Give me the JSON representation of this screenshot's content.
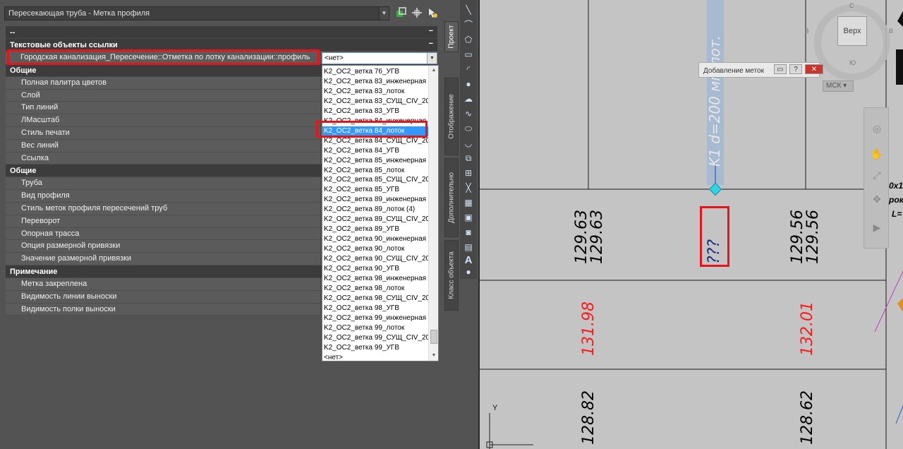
{
  "toolbar": {
    "object_type": "Пересекающая труба - Метка профиля",
    "icons": [
      "quick-select-icon",
      "pick-add-icon",
      "select-objects-icon"
    ]
  },
  "properties": {
    "categories": [
      {
        "label": "--",
        "toggle": "−",
        "rows": []
      },
      {
        "label": "Текстовые объекты ссылки",
        "toggle": "−",
        "rows": [
          {
            "name": "Городская канализация_Пересечение::Отметка по лотку канализации::профиль",
            "value": "<нет>"
          }
        ]
      },
      {
        "label": "Общие",
        "toggle": "−",
        "rows": [
          {
            "name": "Полная палитра цветов"
          },
          {
            "name": "Слой"
          },
          {
            "name": "Тип линий"
          },
          {
            "name": "ЛМасштаб"
          },
          {
            "name": "Стиль печати"
          },
          {
            "name": "Вес линий"
          },
          {
            "name": "Ссылка"
          }
        ]
      },
      {
        "label": "Общие",
        "toggle": "−",
        "rows": [
          {
            "name": "Труба"
          },
          {
            "name": "Вид профиля"
          },
          {
            "name": "Стиль меток профиля пересечений труб"
          },
          {
            "name": "Переворот"
          },
          {
            "name": "Опорная трасса"
          },
          {
            "name": "Опция размерной привязки"
          },
          {
            "name": "Значение размерной привязки"
          }
        ]
      },
      {
        "label": "Примечание",
        "toggle": "−",
        "rows": [
          {
            "name": "Метка закреплена"
          },
          {
            "name": "Видимость линии выноски"
          },
          {
            "name": "Видимость полки выноски"
          }
        ]
      }
    ]
  },
  "dropdown": {
    "current": "<нет>",
    "selected_index": 6,
    "items": [
      "K2_OC2_ветка 76_УГВ",
      "K2_OC2_ветка 83_инженерная",
      "K2_OC2_ветка 83_лоток",
      "K2_OC2_ветка 83_СУЩ_CIV_2016",
      "K2_OC2_ветка 83_УГВ",
      "K2_OC2_ветка 84_инженерная",
      "K2_OC2_ветка 84_лоток",
      "K2_OC2_ветка 84_СУЩ_CIV_2016",
      "K2_OC2_ветка 84_УГВ",
      "K2_OC2_ветка 85_инженерная",
      "K2_OC2_ветка 85_лоток",
      "K2_OC2_ветка 85_СУЩ_CIV_2016",
      "K2_OC2_ветка 85_УГВ",
      "K2_OC2_ветка 89_инженерная",
      "K2_OC2_ветка 89_лоток (4)",
      "K2_OC2_ветка 89_СУЩ_CIV_2016",
      "K2_OC2_ветка 89_УГВ",
      "K2_OC2_ветка 90_инженерная",
      "K2_OC2_ветка 90_лоток",
      "K2_OC2_ветка 90_СУЩ_CIV_2016",
      "K2_OC2_ветка 90_УГВ",
      "K2_OC2_ветка 98_инженерная",
      "K2_OC2_ветка 98_лоток",
      "K2_OC2_ветка 98_СУЩ_CIV_2016",
      "K2_OC2_ветка 98_УГВ",
      "K2_OC2_ветка 99_инженерная",
      "K2_OC2_ветка 99_лоток",
      "K2_OC2_ветка 99_СУЩ_CIV_2016",
      "K2_OC2_ветка 99_УГВ",
      "<нет>"
    ]
  },
  "side_tabs": [
    "Проект",
    "Отображение",
    "Дополнительно",
    "Класс объекта"
  ],
  "viewport": {
    "pipe_label": "K1 d=200 мм лот.",
    "row1": [
      "129.63",
      "129.63",
      "???",
      "129.56",
      "129.56"
    ],
    "row2": [
      "131.98",
      "132.01"
    ],
    "row3": [
      "128.82",
      "128.62"
    ],
    "red_color": "#ff1a1a",
    "pipe_label_color": "#5b3a8e",
    "nav_cube_face": "Верх",
    "nav_cube_letters": [
      "С",
      "З",
      "В",
      "Ю"
    ],
    "ucs": "МСК",
    "axis_y": "Y",
    "edge_text": [
      "0x1",
      "рок",
      "L="
    ],
    "tooltip": "Добавление меток"
  }
}
